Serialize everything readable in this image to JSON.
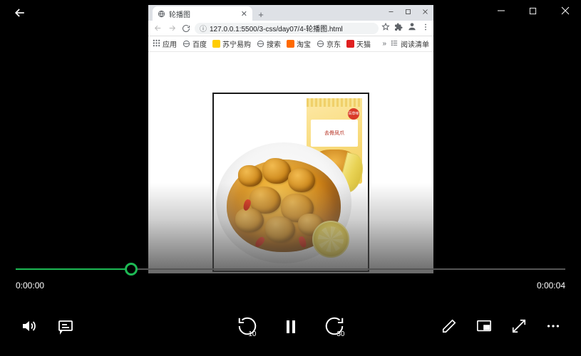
{
  "titlebar": {},
  "browser": {
    "tab_title": "轮播图",
    "url": "127.0.0.1:5500/3-css/day07/4-轮播图.html",
    "bookmarks": {
      "apps": "应用",
      "items": [
        "百度",
        "苏宁易购",
        "搜索",
        "淘宝",
        "京东",
        "天猫"
      ],
      "reading_list": "阅读清单"
    }
  },
  "product": {
    "label_main": "去骨凤爪",
    "brand": "百草味"
  },
  "player": {
    "progress_pct": 21,
    "time_current": "0:00:00",
    "time_total": "0:00:04",
    "skip_back": "10",
    "skip_fwd": "30"
  }
}
